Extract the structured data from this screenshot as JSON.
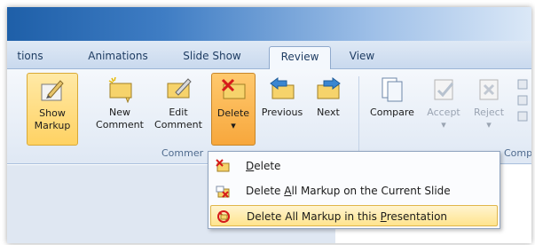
{
  "tabs": [
    {
      "label": "tions"
    },
    {
      "label": "Animations"
    },
    {
      "label": "Slide Show"
    },
    {
      "label": "Review"
    },
    {
      "label": "View"
    }
  ],
  "ribbon": {
    "show_markup": {
      "line1": "Show",
      "line2": "Markup"
    },
    "new_comment": {
      "line1": "New",
      "line2": "Comment"
    },
    "edit_comment": {
      "line1": "Edit",
      "line2": "Comment"
    },
    "delete": {
      "line1": "Delete",
      "arrow": "▾"
    },
    "previous": {
      "label": "Previous"
    },
    "next": {
      "label": "Next"
    },
    "compare": {
      "label": "Compare"
    },
    "accept": {
      "label": "Accept",
      "arrow": "▾"
    },
    "reject": {
      "label": "Reject",
      "arrow": "▾"
    },
    "groups": {
      "comments": "Commer",
      "compare": "Comp"
    }
  },
  "menu": {
    "items": [
      {
        "pre": "",
        "acc": "D",
        "post": "elete"
      },
      {
        "pre": "Delete ",
        "acc": "A",
        "post": "ll Markup on the Current Slide"
      },
      {
        "pre": "Delete All Markup in this ",
        "acc": "P",
        "post": "resentation"
      }
    ]
  },
  "colors": {
    "accent": "#ffd263",
    "highlight": "#ffe48d",
    "ribbon_bg": "#e8eef7"
  }
}
